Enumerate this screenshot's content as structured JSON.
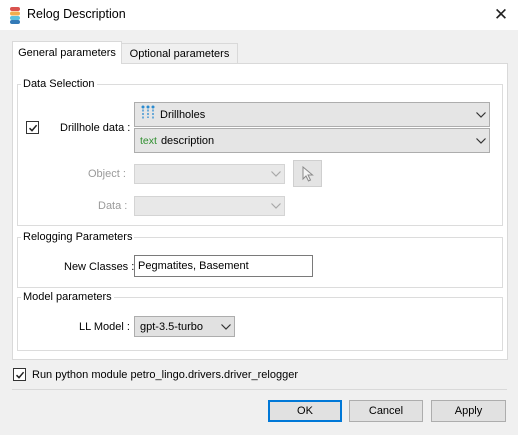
{
  "window": {
    "title": "Relog Description",
    "icon": "database-icon",
    "close_glyph": "✕"
  },
  "tabs": [
    {
      "label": "General parameters",
      "active": true
    },
    {
      "label": "Optional parameters",
      "active": false
    }
  ],
  "data_selection": {
    "title": "Data Selection",
    "drillhole_label": "Drillhole data :",
    "drillhole_checked": true,
    "drillhole_combo": {
      "icon": "drillholes-icon",
      "value": "Drillholes"
    },
    "field_combo": {
      "icon_text": "text",
      "value": "description"
    },
    "object_label": "Object :",
    "data_label": "Data :"
  },
  "relogging": {
    "title": "Relogging Parameters",
    "new_classes_label": "New Classes :",
    "new_classes_value": "Pegmatites, Basement"
  },
  "model": {
    "title": "Model parameters",
    "ll_model_label": "LL Model :",
    "ll_model_value": "gpt-3.5-turbo"
  },
  "run_python": {
    "checked": true,
    "label": "Run python module petro_lingo.drivers.driver_relogger"
  },
  "buttons": {
    "ok": "OK",
    "cancel": "Cancel",
    "apply": "Apply"
  },
  "colors": {
    "accent": "#0078d7",
    "text_icon": "#2f8f2f",
    "drillhole_icon": "#2a8bd0"
  }
}
